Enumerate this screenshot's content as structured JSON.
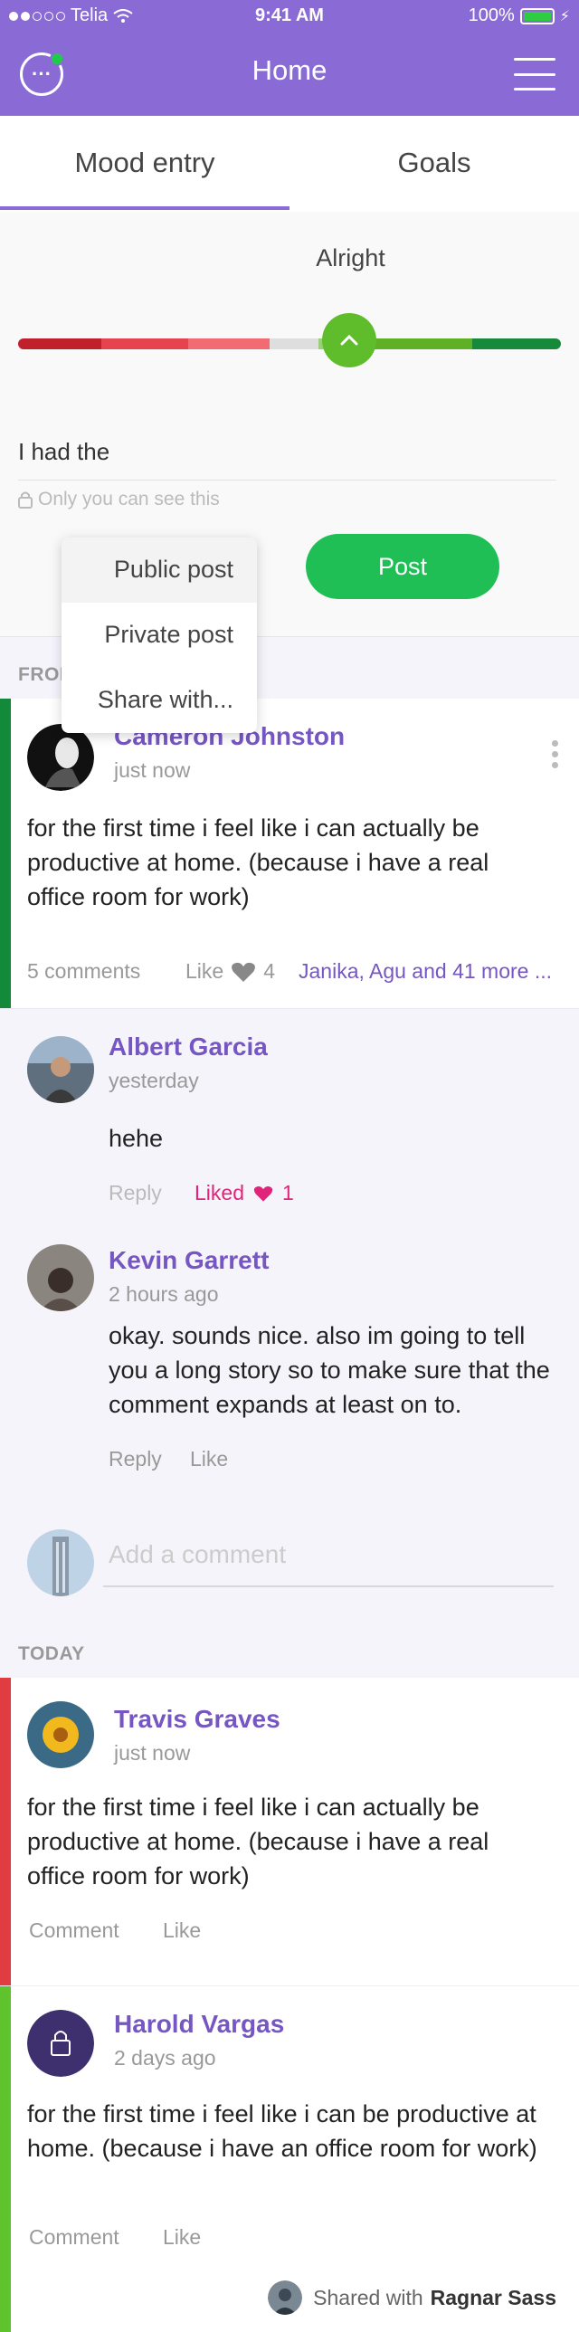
{
  "status": {
    "carrier": "Telia",
    "time": "9:41 AM",
    "battery": "100%"
  },
  "header": {
    "title": "Home",
    "accent": "#8a6bd6"
  },
  "tabs": [
    {
      "label": "Mood entry"
    },
    {
      "label": "Goals"
    }
  ],
  "mood": {
    "label": "Alright",
    "level": 0.59,
    "entry_text": "I had the",
    "privacy_note": "Only you can see this",
    "post_button": "Post"
  },
  "dropdown": {
    "items": [
      "Public post",
      "Private post",
      "Share with..."
    ]
  },
  "sections": {
    "previous": "FROM",
    "today": "TODAY"
  },
  "feed": {
    "post1": {
      "author": "Cameron Johnston",
      "time": "just now",
      "text": "for the first time i feel like i can actually be productive at home. (because i have a real office room for work)",
      "comments_label": "5 comments",
      "like_label": "Like",
      "like_count": "4",
      "likers": "Janika, Agu and 41 more ...",
      "bar_color": "#138a3a"
    },
    "comments": [
      {
        "author": "Albert Garcia",
        "time": "yesterday",
        "text": "hehe",
        "reply": "Reply",
        "liked": "Liked",
        "like_count": "1"
      },
      {
        "author": "Kevin Garrett",
        "time": "2 hours ago",
        "text": "okay. sounds nice. also im going to tell you a long story so to make sure that the comment expands at least on to.",
        "reply": "Reply",
        "like": "Like"
      }
    ],
    "add_comment_placeholder": "Add a comment",
    "post2": {
      "author": "Travis Graves",
      "time": "just now",
      "text": "for the first time i feel like i can actually be productive at home. (because i have a real office room for work)",
      "comment_label": "Comment",
      "like_label": "Like",
      "bar_color": "#e23c43"
    },
    "post3": {
      "author": "Harold Vargas",
      "time": "2 days ago",
      "text": "for the first time i feel like i can be productive at home. (because i have an office room for work)",
      "comment_label": "Comment",
      "like_label": "Like",
      "shared_prefix": "Shared with",
      "shared_with": "Ragnar Sass",
      "bar_color": "#5fc32d"
    }
  }
}
